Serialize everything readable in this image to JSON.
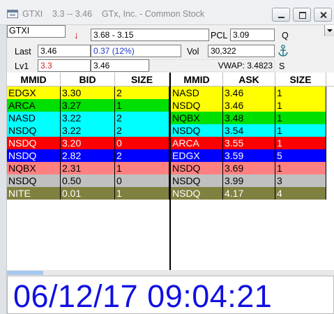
{
  "window": {
    "title": "GTXI    3.3 -- 3.46    GTx, Inc. - Common Stock"
  },
  "quote": {
    "symbol": "GTXI",
    "range": "3.68 - 3.15",
    "pcl_label": "PCL",
    "pcl_value": "3.09",
    "q_label": "Q",
    "last_label": "Last",
    "last_value": "3.46",
    "change": "0.37  (12%)",
    "vol_label": "Vol",
    "vol_value": "30,322",
    "lv1_label": "Lv1",
    "lv1_bid": "3.3",
    "lv1_ask": "3.46",
    "vwap": "VWAP: 3.4823",
    "s_label": "S",
    "colors": {
      "down_arrow": "#e00000",
      "change_text": "#1a35c8",
      "lv1_bid_text": "#d42020"
    }
  },
  "columns": {
    "bid_side": [
      "MMID",
      "BID",
      "SIZE"
    ],
    "ask_side": [
      "MMID",
      "ASK",
      "SIZE"
    ]
  },
  "bids": [
    {
      "mmid": "EDGX",
      "price": "3.30",
      "size": "2",
      "bg": "#ffff00",
      "fg": "#000000"
    },
    {
      "mmid": "ARCA",
      "price": "3.27",
      "size": "1",
      "bg": "#00e000",
      "fg": "#000000"
    },
    {
      "mmid": "NASD",
      "price": "3.22",
      "size": "2",
      "bg": "#00ffff",
      "fg": "#000000"
    },
    {
      "mmid": "NSDQ",
      "price": "3.22",
      "size": "2",
      "bg": "#00ffff",
      "fg": "#000000"
    },
    {
      "mmid": "NSDQ",
      "price": "3.20",
      "size": "0",
      "bg": "#ff0000",
      "fg": "#ffffff"
    },
    {
      "mmid": "NSDQ",
      "price": "2.82",
      "size": "2",
      "bg": "#0000ff",
      "fg": "#ffffff"
    },
    {
      "mmid": "NQBX",
      "price": "2.31",
      "size": "1",
      "bg": "#ff8080",
      "fg": "#000000"
    },
    {
      "mmid": "NSDQ",
      "price": "0.50",
      "size": "0",
      "bg": "#c0c0c0",
      "fg": "#000000"
    },
    {
      "mmid": "NITE",
      "price": "0.01",
      "size": "1",
      "bg": "#808040",
      "fg": "#ffffff"
    }
  ],
  "asks": [
    {
      "mmid": "NASD",
      "price": "3.46",
      "size": "1",
      "bg": "#ffff00",
      "fg": "#000000"
    },
    {
      "mmid": "NSDQ",
      "price": "3.46",
      "size": "1",
      "bg": "#ffff00",
      "fg": "#000000"
    },
    {
      "mmid": "NQBX",
      "price": "3.48",
      "size": "1",
      "bg": "#00e000",
      "fg": "#000000"
    },
    {
      "mmid": "NSDQ",
      "price": "3.54",
      "size": "1",
      "bg": "#00ffff",
      "fg": "#000000"
    },
    {
      "mmid": "ARCA",
      "price": "3.55",
      "size": "1",
      "bg": "#ff0000",
      "fg": "#ffffff"
    },
    {
      "mmid": "EDGX",
      "price": "3.59",
      "size": "5",
      "bg": "#0000ff",
      "fg": "#ffffff"
    },
    {
      "mmid": "NSDQ",
      "price": "3.69",
      "size": "1",
      "bg": "#ff8080",
      "fg": "#000000"
    },
    {
      "mmid": "NSDQ",
      "price": "3.99",
      "size": "3",
      "bg": "#c0c0c0",
      "fg": "#000000"
    },
    {
      "mmid": "NSDQ",
      "price": "4.17",
      "size": "4",
      "bg": "#808040",
      "fg": "#ffffff"
    }
  ],
  "clock": {
    "datetime": "06/12/17 09:04:21",
    "color": "#1010e0"
  },
  "icons": {
    "app": "level2-window-icon",
    "trend": "down-arrow-icon",
    "anchor": "anchor-icon"
  }
}
